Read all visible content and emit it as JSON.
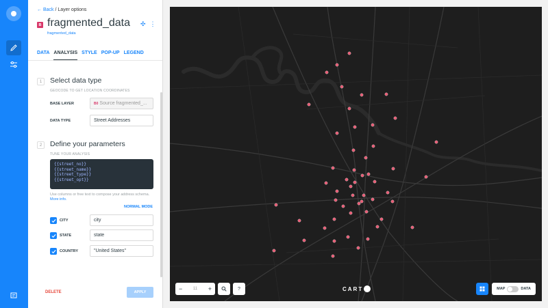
{
  "nav": {
    "brand_color": "#1785fb",
    "items": [
      {
        "icon": "pencil-icon",
        "active": true
      },
      {
        "icon": "sliders-icon",
        "active": false
      }
    ],
    "bottom_icon": "comment-icon"
  },
  "header": {
    "back_link": "Back",
    "breadcrumb": "/ Layer options",
    "layer_letter": "B",
    "layer_name": "fragmented_data",
    "layer_source": "fragmented_data",
    "layer_color": "#d8386a"
  },
  "tabs": [
    {
      "label": "DATA",
      "active": false
    },
    {
      "label": "ANALYSIS",
      "active": true
    },
    {
      "label": "STYLE",
      "active": false
    },
    {
      "label": "POP-UP",
      "active": false
    },
    {
      "label": "LEGEND",
      "active": false
    }
  ],
  "step1": {
    "number": "1",
    "title": "Select data type",
    "subtitle": "GEOCODE TO GET LOCATION COORDINATES",
    "base_layer_label": "BASE LAYER",
    "base_layer_tag": "B0",
    "base_layer_value": "Source fragmented_...",
    "data_type_label": "DATA TYPE",
    "data_type_value": "Street Addresses"
  },
  "step2": {
    "number": "2",
    "title": "Define your parameters",
    "subtitle": "TUNE YOUR ANALYSIS",
    "template_lines": [
      "{{street_no}}",
      "{{street_name}}",
      "{{street_type}}",
      "{{street_opt}}"
    ],
    "help_text": "Use columns or free text to compose your address schema.",
    "help_link": "More info.",
    "mode_link": "NORMAL MODE",
    "fields": [
      {
        "label": "CITY",
        "value": "city",
        "checked": true
      },
      {
        "label": "STATE",
        "value": "state",
        "checked": true
      },
      {
        "label": "COUNTRY",
        "value": "\"United States\"",
        "checked": true
      }
    ]
  },
  "footer": {
    "delete_label": "DELETE",
    "apply_label": "APPLY"
  },
  "map": {
    "zoom_level": "11",
    "zoom_in": "+",
    "zoom_out": "−",
    "search_icon": "search-icon",
    "help_label": "?",
    "brand": "CART",
    "toggle_map_label": "MAP",
    "toggle_data_label": "DATA",
    "point_color": "#e85a73",
    "background": "#1e1e1e"
  }
}
